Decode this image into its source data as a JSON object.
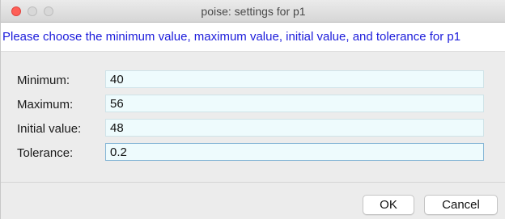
{
  "window": {
    "title": "poise: settings for p1"
  },
  "prompt": "Please choose the minimum value, maximum value, initial value, and tolerance for p1",
  "fields": [
    {
      "label": "Minimum:",
      "value": "40"
    },
    {
      "label": "Maximum:",
      "value": "56"
    },
    {
      "label": "Initial value:",
      "value": "48"
    },
    {
      "label": "Tolerance:",
      "value": "0.2"
    }
  ],
  "buttons": {
    "ok": "OK",
    "cancel": "Cancel"
  },
  "colors": {
    "prompt_text": "#1c1cdb",
    "close_button": "#fe5f57",
    "field_background": "#eefbfd"
  }
}
